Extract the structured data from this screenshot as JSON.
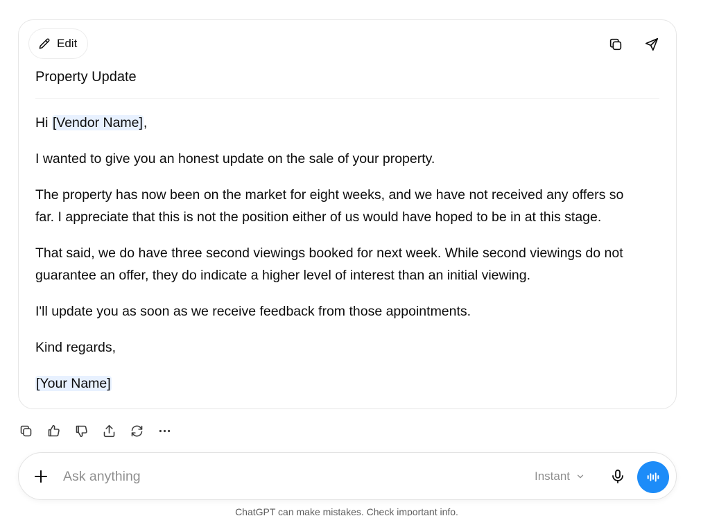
{
  "card": {
    "edit_label": "Edit",
    "subject": "Property Update",
    "greeting_prefix": "Hi ",
    "vendor_placeholder": "[Vendor Name]",
    "greeting_suffix": ",",
    "paragraphs": [
      "I wanted to give you an honest update on the sale of your property.",
      "The property has now been on the market for eight weeks, and we have not received any offers so far. I appreciate that this is not the position either of us would have hoped to be in at this stage.",
      "That said, we do have three second viewings booked for next week. While second viewings do not guarantee an offer, they do indicate a higher level of interest than an initial viewing.",
      "I'll update you as soon as we receive feedback from those appointments."
    ],
    "signoff": "Kind regards,",
    "signature_placeholder": "[Your Name]"
  },
  "icons": {
    "edit": "pencil-icon",
    "copy": "copy-icon",
    "send": "send-icon",
    "like": "thumbs-up-icon",
    "dislike": "thumbs-down-icon",
    "share": "share-icon",
    "regenerate": "regenerate-icon",
    "more": "more-icon",
    "plus": "plus-icon",
    "mic": "microphone-icon",
    "voice": "voice-mode-icon"
  },
  "composer": {
    "placeholder": "Ask anything",
    "model_label": "Instant"
  },
  "footer": "ChatGPT can make mistakes. Check important info.",
  "colors": {
    "accent": "#1d8cf8",
    "placeholder_highlight": "#e8f1ff",
    "muted_text": "#8f8f8f"
  }
}
